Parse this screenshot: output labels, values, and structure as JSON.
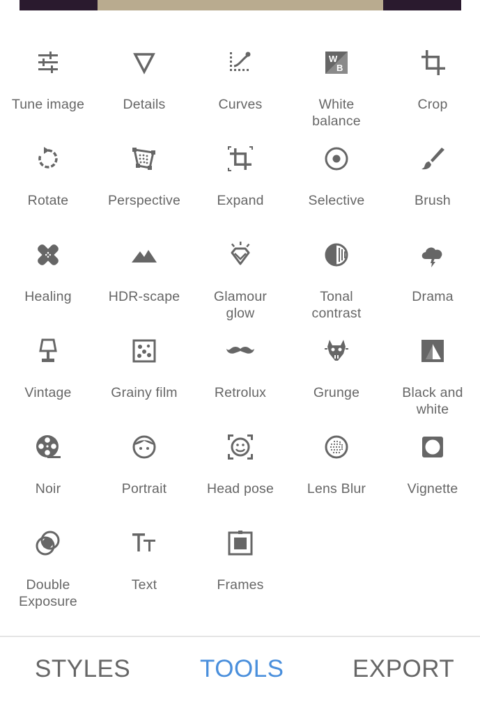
{
  "tools": [
    {
      "label": "Tune image",
      "icon": "tune-image-icon"
    },
    {
      "label": "Details",
      "icon": "details-icon"
    },
    {
      "label": "Curves",
      "icon": "curves-icon"
    },
    {
      "label": "White\nbalance",
      "icon": "white-balance-icon"
    },
    {
      "label": "Crop",
      "icon": "crop-icon"
    },
    {
      "label": "Rotate",
      "icon": "rotate-icon"
    },
    {
      "label": "Perspective",
      "icon": "perspective-icon"
    },
    {
      "label": "Expand",
      "icon": "expand-icon"
    },
    {
      "label": "Selective",
      "icon": "selective-icon"
    },
    {
      "label": "Brush",
      "icon": "brush-icon"
    },
    {
      "label": "Healing",
      "icon": "healing-icon"
    },
    {
      "label": "HDR-scape",
      "icon": "hdr-scape-icon"
    },
    {
      "label": "Glamour\nglow",
      "icon": "glamour-glow-icon"
    },
    {
      "label": "Tonal\ncontrast",
      "icon": "tonal-contrast-icon"
    },
    {
      "label": "Drama",
      "icon": "drama-icon"
    },
    {
      "label": "Vintage",
      "icon": "vintage-icon"
    },
    {
      "label": "Grainy film",
      "icon": "grainy-film-icon"
    },
    {
      "label": "Retrolux",
      "icon": "retrolux-icon"
    },
    {
      "label": "Grunge",
      "icon": "grunge-icon"
    },
    {
      "label": "Black and\nwhite",
      "icon": "black-and-white-icon"
    },
    {
      "label": "Noir",
      "icon": "noir-icon"
    },
    {
      "label": "Portrait",
      "icon": "portrait-icon"
    },
    {
      "label": "Head pose",
      "icon": "head-pose-icon"
    },
    {
      "label": "Lens Blur",
      "icon": "lens-blur-icon"
    },
    {
      "label": "Vignette",
      "icon": "vignette-icon"
    },
    {
      "label": "Double\nExposure",
      "icon": "double-exposure-icon"
    },
    {
      "label": "Text",
      "icon": "text-icon"
    },
    {
      "label": "Frames",
      "icon": "frames-icon"
    }
  ],
  "tabs": {
    "styles": "STYLES",
    "tools": "TOOLS",
    "export": "EXPORT"
  },
  "colors": {
    "icon": "#666666",
    "label": "#666666",
    "active_tab": "#4a8fdc",
    "divider": "#e4e4e4"
  }
}
